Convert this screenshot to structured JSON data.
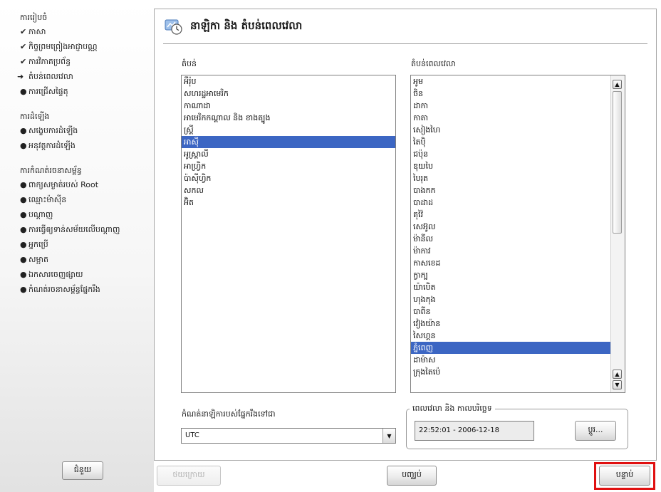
{
  "sidebar": {
    "groups": [
      {
        "header": "ការរៀបចំ",
        "items": [
          {
            "label": "ភាសា",
            "status": "done",
            "mark": "✔"
          },
          {
            "label": "កិច្ចព្រមព្រៀងអាជ្ញាបណ្ណ",
            "status": "done",
            "mark": "✔"
          },
          {
            "label": "ការវិភាគប្រព័ន្ធ",
            "status": "done",
            "mark": "✔"
          },
          {
            "label": "តំបន់ពេលវេលា",
            "status": "current",
            "mark": "➜"
          },
          {
            "label": "ការជ្រើសផ្ទៃតុ",
            "status": "pending",
            "mark": "●"
          }
        ]
      },
      {
        "header": "ការដំឡើង",
        "items": [
          {
            "label": "សង្ខេបការដំឡើង",
            "status": "pending",
            "mark": "●"
          },
          {
            "label": "អនុវត្តការដំឡើង",
            "status": "pending",
            "mark": "●"
          }
        ]
      },
      {
        "header": "ការកំណត់រចនាសម្ព័ន្ធ",
        "items": [
          {
            "label": "ពាក្យសម្ងាត់របស់ Root",
            "status": "pending",
            "mark": "●"
          },
          {
            "label": "ឈ្មោះម៉ាស៊ីន",
            "status": "pending",
            "mark": "●"
          },
          {
            "label": "បណ្ដាញ",
            "status": "pending",
            "mark": "●"
          },
          {
            "label": "ការធ្វើឲ្យទាន់សម័យលើបណ្ដាញ",
            "status": "pending",
            "mark": "●"
          },
          {
            "label": "អ្នកប្រើ",
            "status": "pending",
            "mark": "●"
          },
          {
            "label": "សម្អាត",
            "status": "pending",
            "mark": "●"
          },
          {
            "label": "ឯកសារចេញផ្សាយ",
            "status": "pending",
            "mark": "●"
          },
          {
            "label": "កំណត់រចនាសម្ព័ន្ធផ្នែករឹង",
            "status": "pending",
            "mark": "●"
          }
        ]
      }
    ],
    "help_label": "ជំនួយ"
  },
  "main": {
    "title": "នាឡិកា និង តំបន់ពេលវេលា",
    "region_label": "តំបន់",
    "timezone_label": "តំបន់ពេលវេលា",
    "regions": [
      "អឺរ៉ុប",
      "សហរដ្ឋអាមេរិក",
      "កាណាដា",
      "អាមេរិកកណ្ដាល និង ខាងត្បូង",
      "ស្រ្ដី",
      "អាស៊ី",
      "អូស្ត្រាលី",
      "អាហ្វ្រិក",
      "ប៉ាស៊ីហ្វិក",
      "សកល",
      "អ៊ិត"
    ],
    "regions_selected_index": 5,
    "timezones": [
      "អូម",
      "ចិន",
      "ដាកា",
      "កាតា",
      "សៀងហៃ",
      "តៃប៉ិ",
      "ជប៉ុន",
      "ឌុយបៃ",
      "បៃរុត",
      "បាងកក",
      "បាដាដ",
      "គុវ៉ៃ",
      "សេអ៊ូល",
      "ម៉ានីល",
      "ម៉ាកាវ",
      "កាសខេដ",
      "ក្វាក្ប",
      "យ៉ាបេិត",
      "ហុងកុង",
      "បាពីន",
      "វៀងយ៉ាន",
      "សៃហ្គន",
      "ភ្នំពេញ",
      "ដាម៉ាស",
      "ក្រុងតៃប៉េ"
    ],
    "timezones_selected_index": 22,
    "hwclock_label": "កំណត់នាឡិការបស់ផ្នែករឹងទៅជា",
    "hwclock_value": "UTC",
    "datetime_group_title": "ពេលវេលា និង កាលបរិច្ឆេទ",
    "datetime_value": "22:52:01 - 2006-12-18",
    "change_button": "ប្ដូរ..."
  },
  "footer": {
    "back_label": "ថយក្រោយ",
    "abort_label": "បញ្ឈប់",
    "next_label": "បន្ទាប់"
  },
  "colors": {
    "selection": "#3c66c3",
    "highlight_box": "#e01010"
  }
}
